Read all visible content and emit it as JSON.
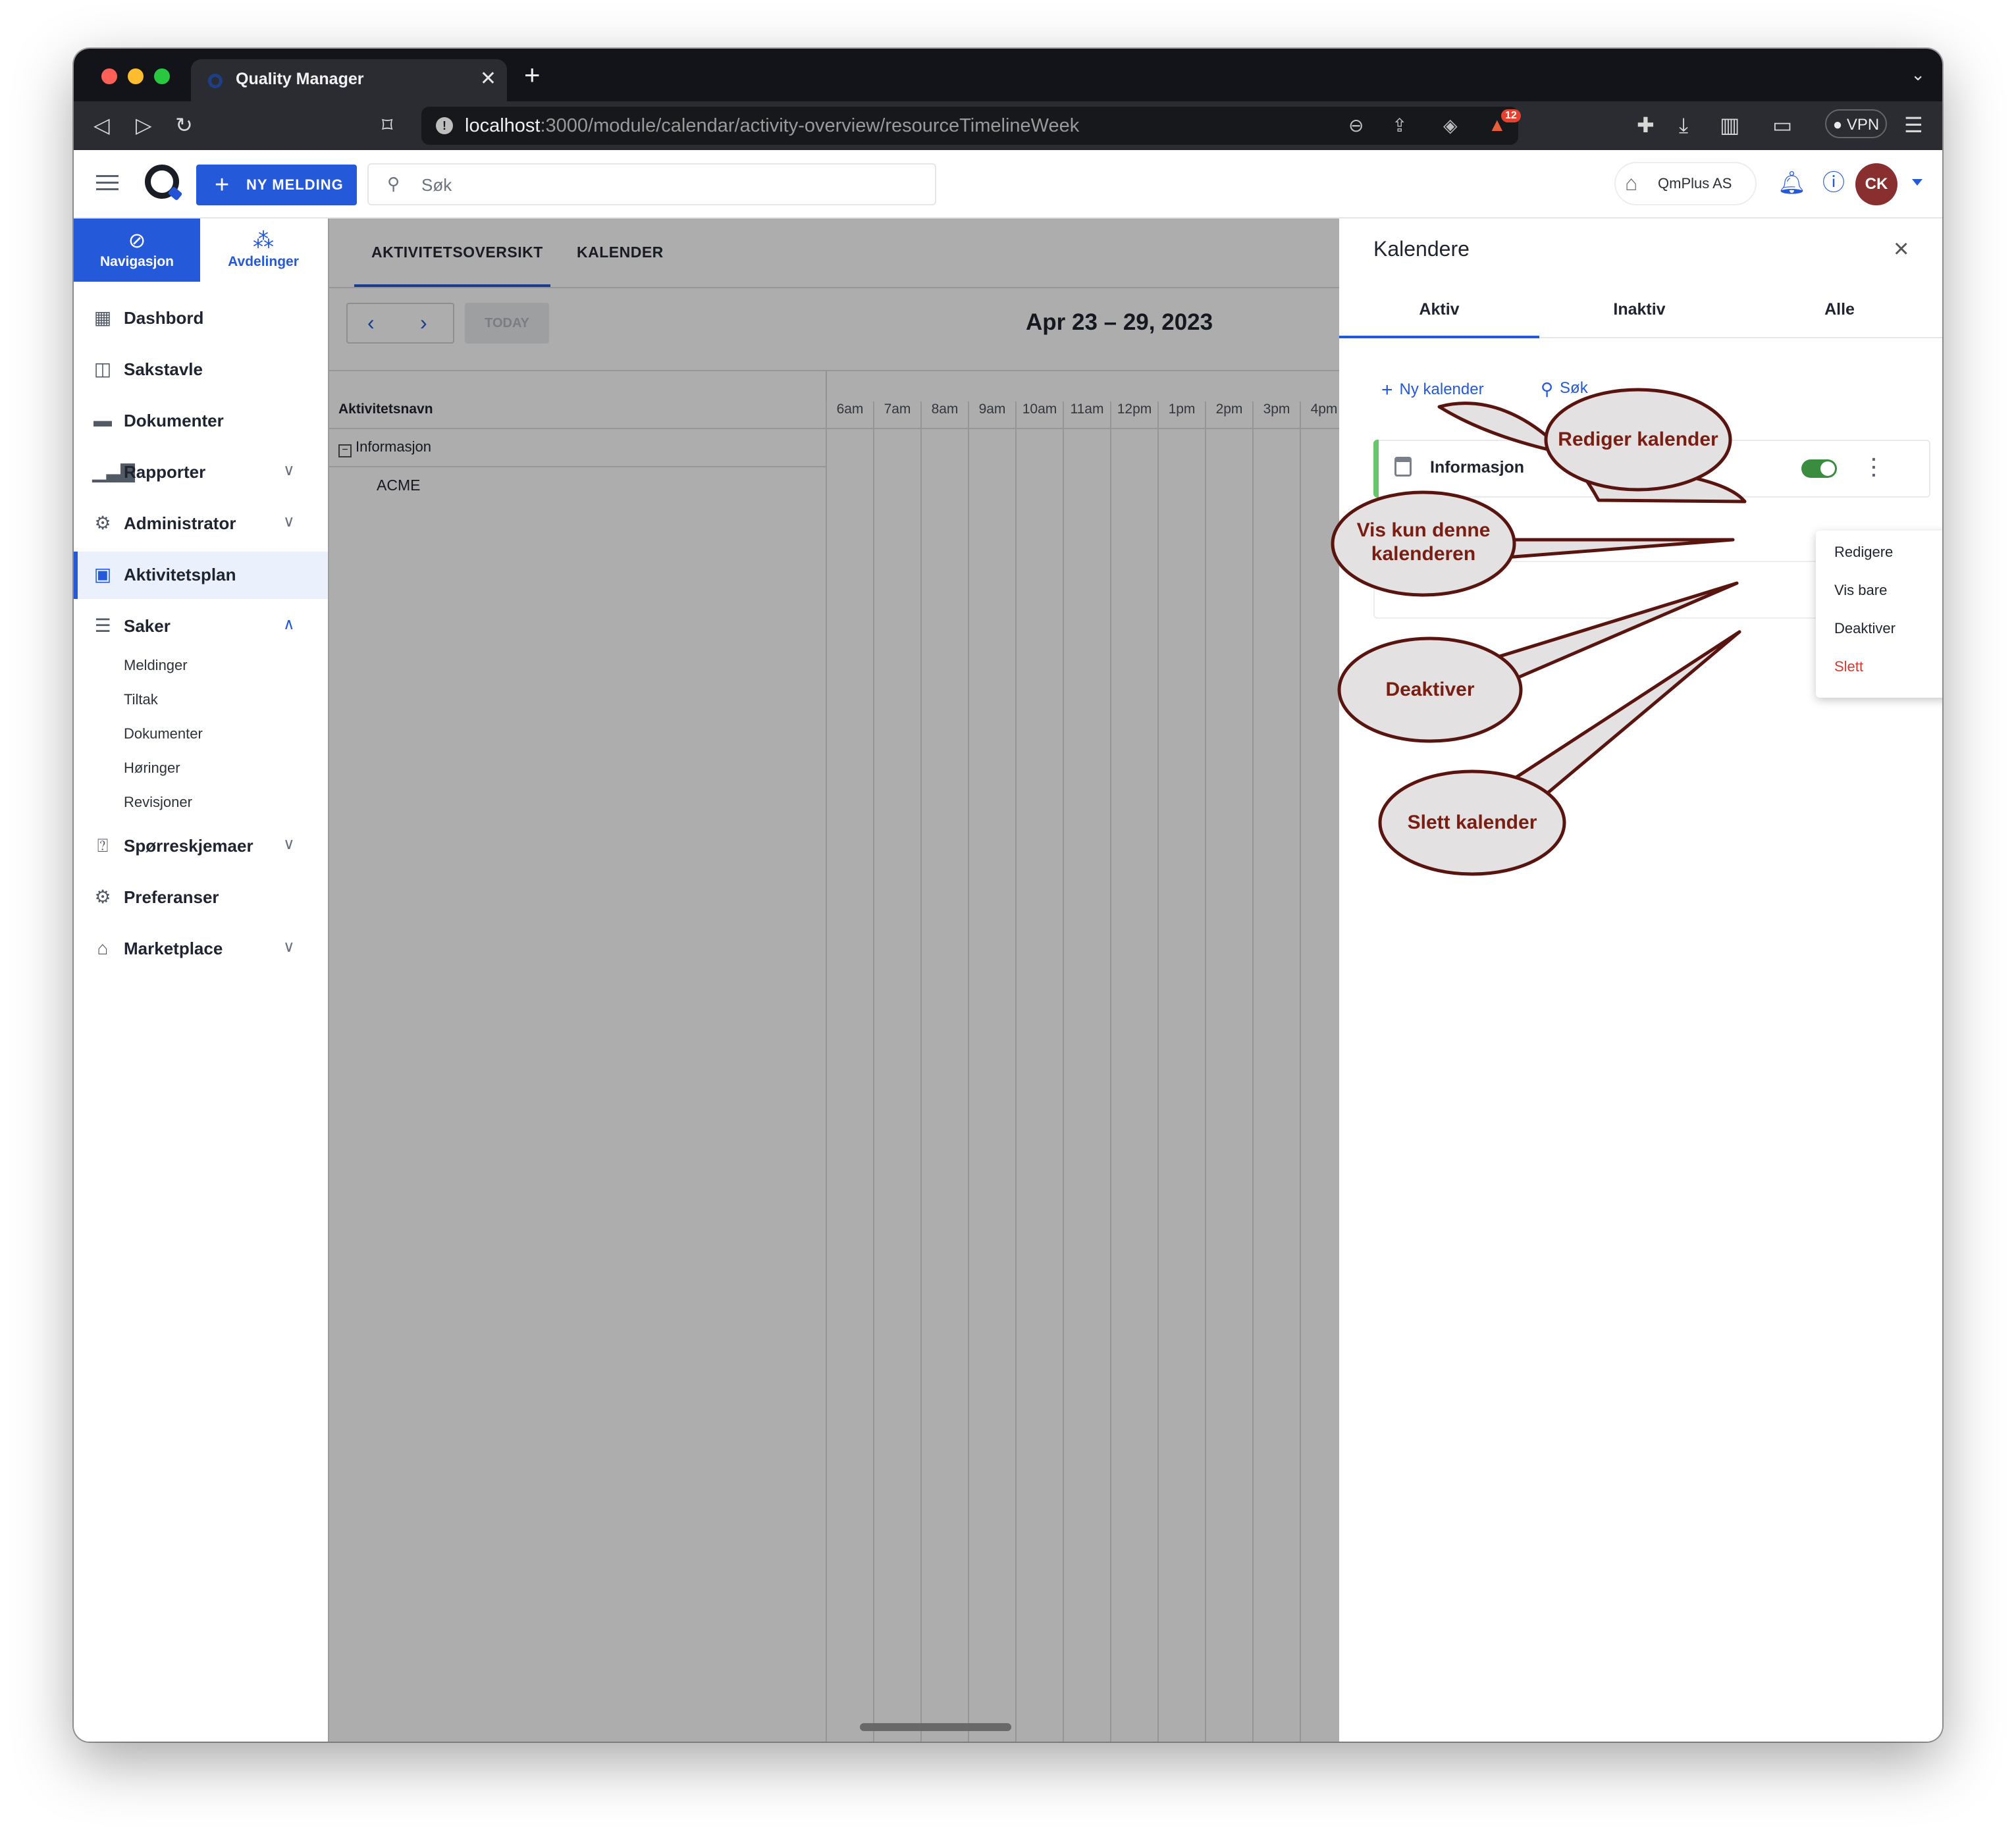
{
  "browser": {
    "tab_title": "Quality Manager",
    "url_host": "localhost",
    "url_path": ":3000/module/calendar/activity-overview/resourceTimelineWeek",
    "shield_badge": "12",
    "vpn_label": "VPN"
  },
  "header": {
    "new_message_label": "NY MELDING",
    "search_placeholder": "Søk",
    "org_name": "QmPlus AS",
    "avatar_initials": "CK"
  },
  "sidebar": {
    "tabs": [
      {
        "label": "Navigasjon",
        "icon": "compass-icon"
      },
      {
        "label": "Avdelinger",
        "icon": "org-chart-icon"
      }
    ],
    "items": [
      {
        "label": "Dashbord",
        "icon": "dashboard-icon"
      },
      {
        "label": "Sakstavle",
        "icon": "board-icon"
      },
      {
        "label": "Dokumenter",
        "icon": "folder-icon"
      },
      {
        "label": "Rapporter",
        "icon": "bar-chart-icon"
      },
      {
        "label": "Administrator",
        "icon": "admin-gears-icon"
      },
      {
        "label": "Aktivitetsplan",
        "icon": "calendar-icon"
      },
      {
        "label": "Saker",
        "icon": "cases-icon"
      },
      {
        "label": "Spørreskjemaer",
        "icon": "questionnaire-icon"
      },
      {
        "label": "Preferanser",
        "icon": "gear-icon"
      },
      {
        "label": "Marketplace",
        "icon": "store-icon"
      }
    ],
    "saker_sub": [
      "Meldinger",
      "Tiltak",
      "Dokumenter",
      "Høringer",
      "Revisjoner"
    ]
  },
  "main": {
    "tabs": [
      "AKTIVITETSOVERSIKT",
      "KALENDER"
    ],
    "today_label": "TODAY",
    "date_range": "Apr 23 – 29, 2023",
    "resource_header": "Aktivitetsnavn",
    "resource_group": "Informasjon",
    "resource_child": "ACME",
    "hours": [
      "6am",
      "7am",
      "8am",
      "9am",
      "10am",
      "11am",
      "12pm",
      "1pm",
      "2pm",
      "3pm",
      "4pm"
    ]
  },
  "panel": {
    "title": "Kalendere",
    "tabs": [
      "Aktiv",
      "Inaktiv",
      "Alle"
    ],
    "new_calendar_label": "Ny kalender",
    "search_label": "Søk",
    "calendar_name": "Informasjon",
    "menu": [
      "Redigere",
      "Vis bare",
      "Deaktiver",
      "Slett"
    ]
  },
  "callouts": {
    "edit": "Rediger kalender",
    "show_only_line1": "Vis kun denne",
    "show_only_line2": "kalenderen",
    "deactivate": "Deaktiver",
    "delete": "Slett kalender"
  },
  "colors": {
    "accent": "#2459d9",
    "danger": "#d63a2f",
    "callout_text": "#7a1d12",
    "callout_border": "#5a1410",
    "callout_fill": "#e3e1e1",
    "toggle_on": "#3a8c3f"
  }
}
